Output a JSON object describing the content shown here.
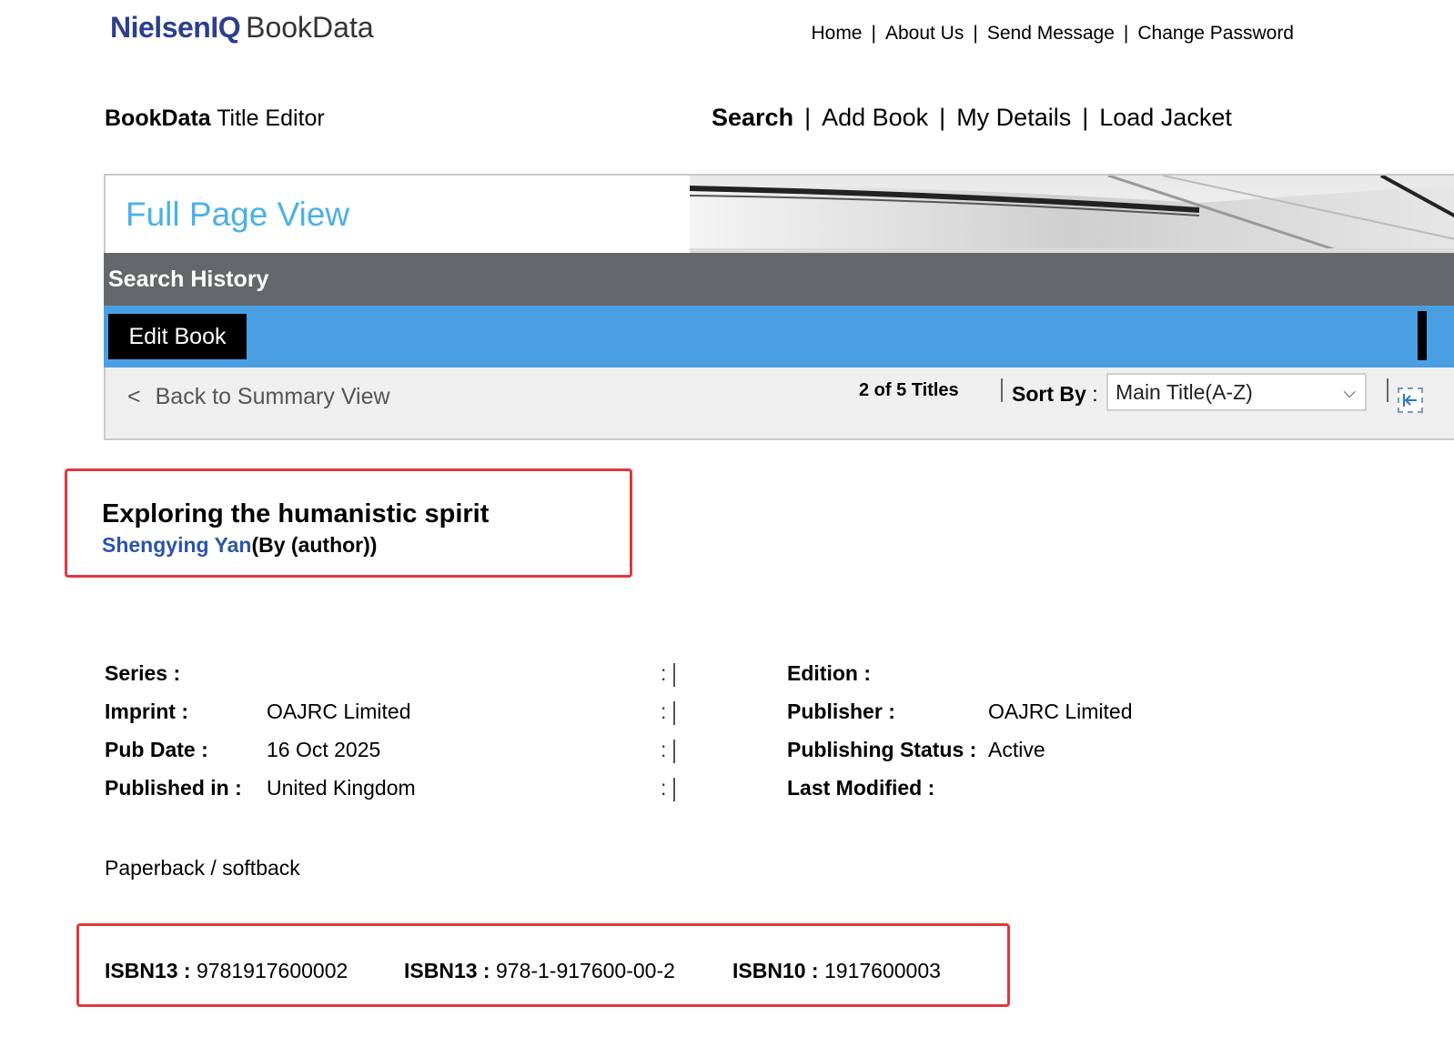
{
  "header": {
    "logo_brand": "NielsenIQ",
    "logo_product": "BookData",
    "top_nav": [
      "Home",
      "About Us",
      "Send Message",
      "Change Password"
    ]
  },
  "app": {
    "title_bold": "BookData",
    "title_rest": "Title Editor"
  },
  "main_nav": {
    "active": "Search",
    "items": [
      "Search",
      "Add Book",
      "My Details",
      "Load Jacket"
    ]
  },
  "banner": {
    "title": "Full Page View"
  },
  "history_bar": {
    "label": "Search History"
  },
  "tabs": {
    "edit_book": "Edit Book"
  },
  "toolbar": {
    "back_chevron": "<",
    "back_label": "Back to Summary View",
    "titles_count": "2 of 5 Titles",
    "sort_label": "Sort By",
    "sort_colon": ":",
    "sort_value": "Main Title(A-Z)",
    "first_button_icon": "first-page-icon"
  },
  "book": {
    "title": "Exploring the humanistic spirit",
    "author": "Shengying Yan",
    "author_role": "(By (author))"
  },
  "details": {
    "left": [
      {
        "label": "Series :",
        "value": ""
      },
      {
        "label": "Imprint :",
        "value": "OAJRC Limited"
      },
      {
        "label": "Pub Date :",
        "value": "16 Oct 2025"
      },
      {
        "label": "Published in :",
        "value": "United Kingdom"
      }
    ],
    "mid_colon": ":",
    "right": [
      {
        "label": "Edition :",
        "value": ""
      },
      {
        "label": "Publisher :",
        "value": "OAJRC Limited"
      },
      {
        "label": "Publishing Status :",
        "value": "Active"
      },
      {
        "label": "Last Modified :",
        "value": ""
      }
    ]
  },
  "format": "Paperback / softback",
  "isbn": [
    {
      "label": "ISBN13 :",
      "value": "9781917600002"
    },
    {
      "label": "ISBN13 :",
      "value": "978-1-917600-00-2"
    },
    {
      "label": "ISBN10 :",
      "value": "1917600003"
    }
  ],
  "colors": {
    "brand": "#2b3f8c",
    "banner_title": "#4cb0e8",
    "history_bar": "#65686b",
    "blue_bar": "#4a9fe3",
    "highlight_box": "#e0383e",
    "author_link": "#2c55a8"
  }
}
